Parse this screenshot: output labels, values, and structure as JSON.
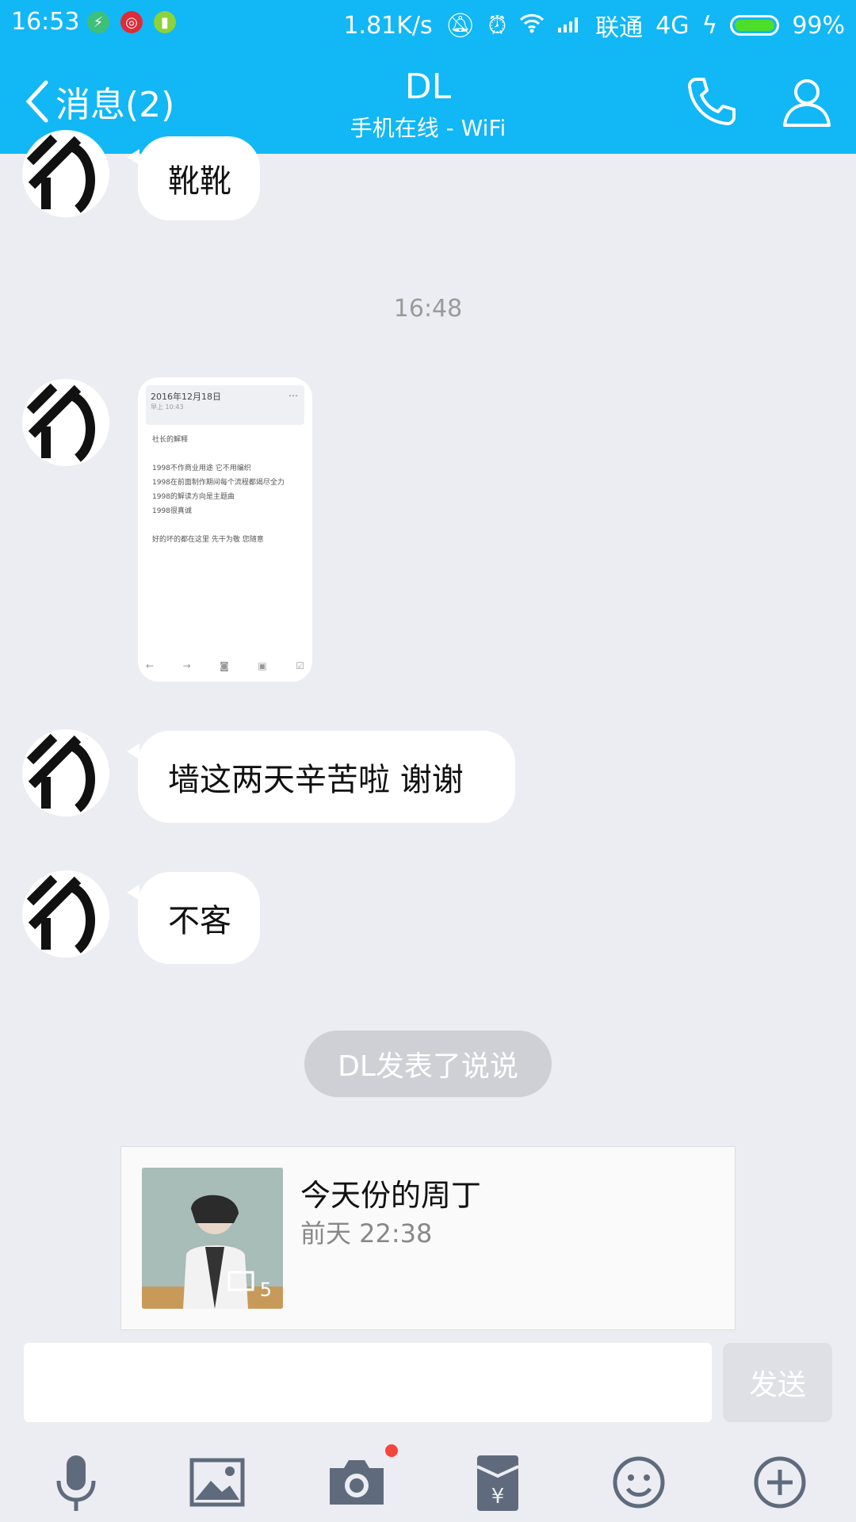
{
  "status_bar": {
    "time": "16:53",
    "net_speed": "1.81K/s",
    "carrier": "联通",
    "network": "4G",
    "battery": "99%",
    "battery_level": 0.99
  },
  "header": {
    "back_label": "消息(2)",
    "title": "DL",
    "subtitle": "手机在线 - WiFi"
  },
  "messages": [
    {
      "type": "text",
      "text": "靴靴"
    },
    {
      "type": "time",
      "text": "16:48"
    },
    {
      "type": "image",
      "note": {
        "date": "2016年12月18日",
        "sub": "早上 10:43",
        "lines": [
          "社长的解释",
          "",
          "1998不作商业用途 它不用编织",
          "1998在前面制作期间每个流程都竭尽全力",
          "1998的解读方向是主题曲",
          "1998很真诚",
          "",
          "好的坏的都在这里 先干为敬 您随意"
        ]
      }
    },
    {
      "type": "text",
      "text": "墙这两天辛苦啦 谢谢"
    },
    {
      "type": "text",
      "text": "不客"
    }
  ],
  "system_pill": "DL发表了说说",
  "post_card": {
    "title": "今天份的周丁",
    "time": "前天 22:38",
    "photo_count": "5"
  },
  "input": {
    "placeholder": "",
    "send_label": "发送"
  },
  "toolbar": {
    "icons": [
      "microphone-icon",
      "image-icon",
      "camera-icon",
      "red-packet-icon",
      "emoji-icon",
      "plus-icon"
    ]
  },
  "colors": {
    "header": "#12b7f5",
    "background": "#ecedf2",
    "toolbar_icon": "#5f6b7d"
  }
}
